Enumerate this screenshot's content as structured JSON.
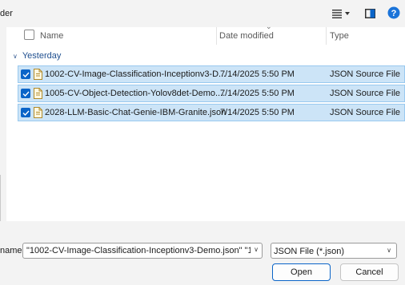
{
  "toolbar": {
    "partial_title": "der",
    "icons": [
      "view-menu-icon",
      "chevron-down-icon",
      "preview-pane-icon",
      "help-icon"
    ],
    "help_color": "#1a73d9"
  },
  "columns": {
    "name": "Name",
    "date_modified": "Date modified",
    "type": "Type"
  },
  "group": {
    "label": "Yesterday"
  },
  "files": [
    {
      "name": "1002-CV-Image-Classification-Inceptionv3-D...",
      "date": "7/14/2025 5:50 PM",
      "type": "JSON Source File",
      "checked": true
    },
    {
      "name": "1005-CV-Object-Detection-Yolov8det-Demo....",
      "date": "7/14/2025 5:50 PM",
      "type": "JSON Source File",
      "checked": true
    },
    {
      "name": "2028-LLM-Basic-Chat-Genie-IBM-Granite.json",
      "date": "7/14/2025 5:50 PM",
      "type": "JSON Source File",
      "checked": true
    }
  ],
  "footer": {
    "filename_label": "name:",
    "filename_value": "\"1002-CV-Image-Classification-Inceptionv3-Demo.json\" \"1005-",
    "filetype_value": "JSON File (*.json)",
    "open_label": "Open",
    "cancel_label": "Cancel"
  },
  "colors": {
    "selection_bg": "#cce4f7",
    "selection_border": "#99c9ef",
    "checkbox_accent": "#0a64c8",
    "group_text": "#1f4f8f"
  }
}
